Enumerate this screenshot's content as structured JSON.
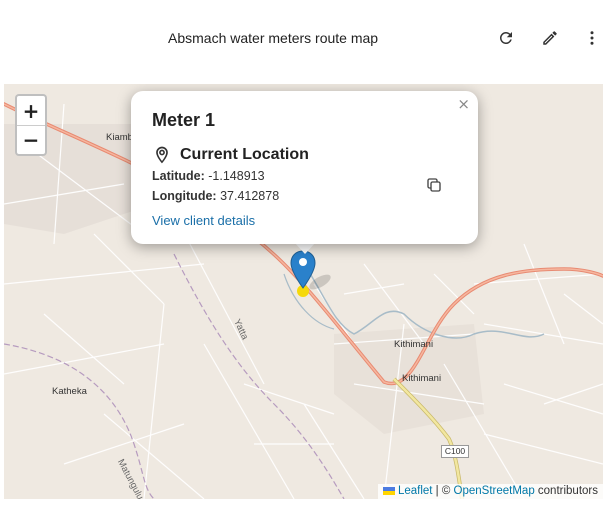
{
  "header": {
    "title": "Absmach water meters route map",
    "refresh_icon": "refresh-icon",
    "edit_icon": "pencil-icon",
    "more_icon": "more-vertical-icon"
  },
  "map": {
    "zoom_in": "+",
    "zoom_out": "−",
    "labels": {
      "kithimani_1": "Kithimani",
      "kithimani_2": "Kithimani",
      "katheka": "Katheka",
      "kiamb": "Kiamb",
      "yatta": "Yatta",
      "matungulu": "Matungulu",
      "c100": "C100"
    },
    "attribution": {
      "leaflet": "Leaflet",
      "separator": " | © ",
      "osm": "OpenStreetMap",
      "contributors": " contributors"
    }
  },
  "popup": {
    "title": "Meter 1",
    "location_label": "Current Location",
    "latitude_label": "Latitude:",
    "latitude_value": "-1.148913",
    "longitude_label": "Longitude:",
    "longitude_value": "37.412878",
    "link_text": "View client details",
    "close": "×"
  },
  "colors": {
    "marker": "#2a81cb",
    "marker_dot": "#f5d90a",
    "primary_road": "#e88a72",
    "secondary_road": "#f2e7a0",
    "link": "#1a6fa8"
  }
}
